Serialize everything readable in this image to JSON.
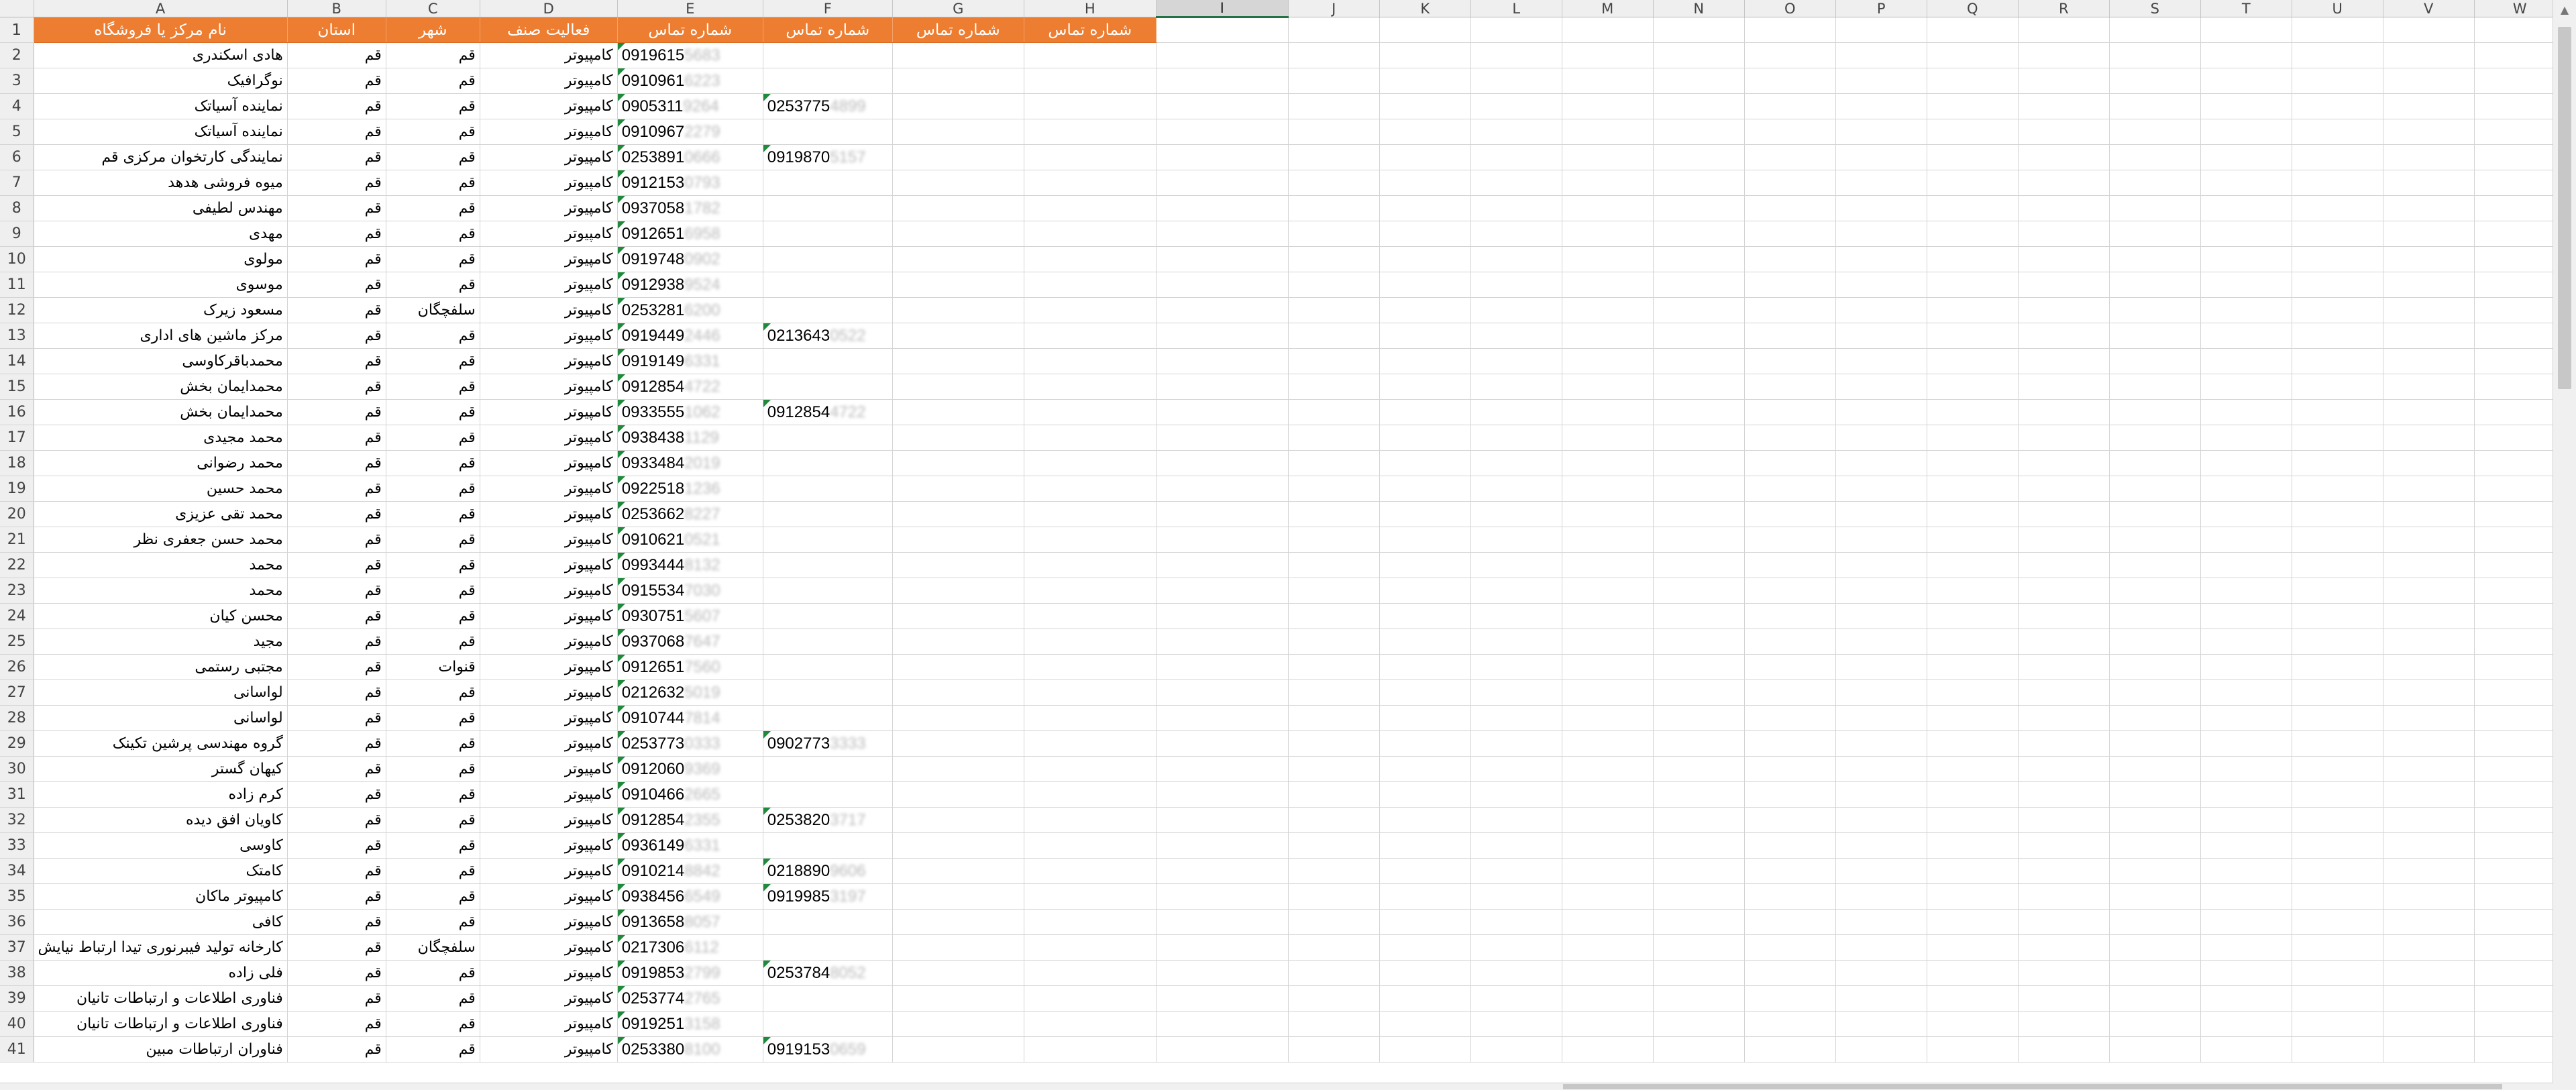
{
  "column_headers": [
    "A",
    "B",
    "C",
    "D",
    "E",
    "F",
    "G",
    "H",
    "I",
    "J",
    "K",
    "L",
    "M",
    "N",
    "O",
    "P",
    "Q",
    "R",
    "S",
    "T",
    "U",
    "V",
    "W"
  ],
  "selected_column": "I",
  "header_row": {
    "a": "نام مرکز یا فروشگاه",
    "b": "استان",
    "c": "شهر",
    "d": "فعالیت صنف",
    "e": "شماره تماس",
    "f": "شماره تماس",
    "g": "شماره تماس",
    "h": "شماره تماس"
  },
  "rows": [
    {
      "n": 2,
      "a": "هادی اسکندری",
      "b": "قم",
      "c": "قم",
      "d": "کامپیوتر",
      "e": "0919615",
      "e_h": "5683",
      "f": "",
      "f_h": ""
    },
    {
      "n": 3,
      "a": "نوگرافیک",
      "b": "قم",
      "c": "قم",
      "d": "کامپیوتر",
      "e": "0910961",
      "e_h": "6223",
      "f": "",
      "f_h": ""
    },
    {
      "n": 4,
      "a": "نماینده آسیاتک",
      "b": "قم",
      "c": "قم",
      "d": "کامپیوتر",
      "e": "0905311",
      "e_h": "9264",
      "f": "0253775",
      "f_h": "4899"
    },
    {
      "n": 5,
      "a": "نماینده آسیاتک",
      "b": "قم",
      "c": "قم",
      "d": "کامپیوتر",
      "e": "0910967",
      "e_h": "2279",
      "f": "",
      "f_h": ""
    },
    {
      "n": 6,
      "a": "نمایندگی کارتخوان مرکزی قم",
      "b": "قم",
      "c": "قم",
      "d": "کامپیوتر",
      "e": "0253891",
      "e_h": "0666",
      "f": "0919870",
      "f_h": "5157"
    },
    {
      "n": 7,
      "a": "میوه فروشی هدهد",
      "b": "قم",
      "c": "قم",
      "d": "کامپیوتر",
      "e": "0912153",
      "e_h": "0793",
      "f": "",
      "f_h": ""
    },
    {
      "n": 8,
      "a": "مهندس لطیفی",
      "b": "قم",
      "c": "قم",
      "d": "کامپیوتر",
      "e": "0937058",
      "e_h": "1782",
      "f": "",
      "f_h": ""
    },
    {
      "n": 9,
      "a": "مهدی",
      "b": "قم",
      "c": "قم",
      "d": "کامپیوتر",
      "e": "0912651",
      "e_h": "6958",
      "f": "",
      "f_h": ""
    },
    {
      "n": 10,
      "a": "مولوی",
      "b": "قم",
      "c": "قم",
      "d": "کامپیوتر",
      "e": "0919748",
      "e_h": "0902",
      "f": "",
      "f_h": ""
    },
    {
      "n": 11,
      "a": "موسوی",
      "b": "قم",
      "c": "قم",
      "d": "کامپیوتر",
      "e": "0912938",
      "e_h": "9524",
      "f": "",
      "f_h": ""
    },
    {
      "n": 12,
      "a": "مسعود زیرک",
      "b": "قم",
      "c": "سلفچگان",
      "d": "کامپیوتر",
      "e": "0253281",
      "e_h": "6200",
      "f": "",
      "f_h": ""
    },
    {
      "n": 13,
      "a": "مرکز ماشین های اداری",
      "b": "قم",
      "c": "قم",
      "d": "کامپیوتر",
      "e": "0919449",
      "e_h": "2446",
      "f": "0213643",
      "f_h": "0522"
    },
    {
      "n": 14,
      "a": "محمدباقرکاوسی",
      "b": "قم",
      "c": "قم",
      "d": "کامپیوتر",
      "e": "0919149",
      "e_h": "6331",
      "f": "",
      "f_h": ""
    },
    {
      "n": 15,
      "a": "محمدایمان بخش",
      "b": "قم",
      "c": "قم",
      "d": "کامپیوتر",
      "e": "0912854",
      "e_h": "4722",
      "f": "",
      "f_h": ""
    },
    {
      "n": 16,
      "a": "محمدایمان بخش",
      "b": "قم",
      "c": "قم",
      "d": "کامپیوتر",
      "e": "0933555",
      "e_h": "1062",
      "f": "0912854",
      "f_h": "4722"
    },
    {
      "n": 17,
      "a": "محمد مجیدی",
      "b": "قم",
      "c": "قم",
      "d": "کامپیوتر",
      "e": "0938438",
      "e_h": "1129",
      "f": "",
      "f_h": ""
    },
    {
      "n": 18,
      "a": "محمد رضوانی",
      "b": "قم",
      "c": "قم",
      "d": "کامپیوتر",
      "e": "0933484",
      "e_h": "2019",
      "f": "",
      "f_h": ""
    },
    {
      "n": 19,
      "a": "محمد حسین",
      "b": "قم",
      "c": "قم",
      "d": "کامپیوتر",
      "e": "0922518",
      "e_h": "1236",
      "f": "",
      "f_h": ""
    },
    {
      "n": 20,
      "a": "محمد تقی عزیزی",
      "b": "قم",
      "c": "قم",
      "d": "کامپیوتر",
      "e": "0253662",
      "e_h": "8227",
      "f": "",
      "f_h": ""
    },
    {
      "n": 21,
      "a": "محمد  حسن جعفری نظر",
      "b": "قم",
      "c": "قم",
      "d": "کامپیوتر",
      "e": "0910621",
      "e_h": "0521",
      "f": "",
      "f_h": ""
    },
    {
      "n": 22,
      "a": "محمد",
      "b": "قم",
      "c": "قم",
      "d": "کامپیوتر",
      "e": "0993444",
      "e_h": "8132",
      "f": "",
      "f_h": ""
    },
    {
      "n": 23,
      "a": "محمد",
      "b": "قم",
      "c": "قم",
      "d": "کامپیوتر",
      "e": "0915534",
      "e_h": "7030",
      "f": "",
      "f_h": ""
    },
    {
      "n": 24,
      "a": "محسن کیان",
      "b": "قم",
      "c": "قم",
      "d": "کامپیوتر",
      "e": "0930751",
      "e_h": "5607",
      "f": "",
      "f_h": ""
    },
    {
      "n": 25,
      "a": "مجید",
      "b": "قم",
      "c": "قم",
      "d": "کامپیوتر",
      "e": "0937068",
      "e_h": "7647",
      "f": "",
      "f_h": ""
    },
    {
      "n": 26,
      "a": "مجتبی رستمی",
      "b": "قم",
      "c": "قنوات",
      "d": "کامپیوتر",
      "e": "0912651",
      "e_h": "7560",
      "f": "",
      "f_h": ""
    },
    {
      "n": 27,
      "a": "لواسانی",
      "b": "قم",
      "c": "قم",
      "d": "کامپیوتر",
      "e": "0212632",
      "e_h": "5019",
      "f": "",
      "f_h": ""
    },
    {
      "n": 28,
      "a": "لواسانی",
      "b": "قم",
      "c": "قم",
      "d": "کامپیوتر",
      "e": "0910744",
      "e_h": "7814",
      "f": "",
      "f_h": ""
    },
    {
      "n": 29,
      "a": "گروه مهندسی پرشین تکینک",
      "b": "قم",
      "c": "قم",
      "d": "کامپیوتر",
      "e": "0253773",
      "e_h": "0333",
      "f": "0902773",
      "f_h": "3333"
    },
    {
      "n": 30,
      "a": "کیهان گستر",
      "b": "قم",
      "c": "قم",
      "d": "کامپیوتر",
      "e": "0912060",
      "e_h": "9369",
      "f": "",
      "f_h": ""
    },
    {
      "n": 31,
      "a": "کرم زاده",
      "b": "قم",
      "c": "قم",
      "d": "کامپیوتر",
      "e": "0910466",
      "e_h": "2665",
      "f": "",
      "f_h": ""
    },
    {
      "n": 32,
      "a": "کاویان افق دیده",
      "b": "قم",
      "c": "قم",
      "d": "کامپیوتر",
      "e": "0912854",
      "e_h": "2355",
      "f": "0253820",
      "f_h": "3717"
    },
    {
      "n": 33,
      "a": "کاوسی",
      "b": "قم",
      "c": "قم",
      "d": "کامپیوتر",
      "e": "0936149",
      "e_h": "6331",
      "f": "",
      "f_h": ""
    },
    {
      "n": 34,
      "a": "کامتک",
      "b": "قم",
      "c": "قم",
      "d": "کامپیوتر",
      "e": "0910214",
      "e_h": "8842",
      "f": "0218890",
      "f_h": "9606"
    },
    {
      "n": 35,
      "a": "کامپیوتر ماکان",
      "b": "قم",
      "c": "قم",
      "d": "کامپیوتر",
      "e": "0938456",
      "e_h": "6549",
      "f": "0919985",
      "f_h": "3197"
    },
    {
      "n": 36,
      "a": "کافی",
      "b": "قم",
      "c": "قم",
      "d": "کامپیوتر",
      "e": "0913658",
      "e_h": "8057",
      "f": "",
      "f_h": ""
    },
    {
      "n": 37,
      "a": "کارخانه تولید فیبرنوری تیدا ارتباط نیایش",
      "b": "قم",
      "c": "سلفچگان",
      "d": "کامپیوتر",
      "e": "0217306",
      "e_h": "6112",
      "f": "",
      "f_h": ""
    },
    {
      "n": 38,
      "a": "فلی زاده",
      "b": "قم",
      "c": "قم",
      "d": "کامپیوتر",
      "e": "0919853",
      "e_h": "2799",
      "f": "0253784",
      "f_h": "8052"
    },
    {
      "n": 39,
      "a": "فناوری اطلاعات و ارتباطات تانیان",
      "b": "قم",
      "c": "قم",
      "d": "کامپیوتر",
      "e": "0253774",
      "e_h": "2765",
      "f": "",
      "f_h": ""
    },
    {
      "n": 40,
      "a": "فناوری اطلاعات و ارتباطات تانیان",
      "b": "قم",
      "c": "قم",
      "d": "کامپیوتر",
      "e": "0919251",
      "e_h": "3158",
      "f": "",
      "f_h": ""
    },
    {
      "n": 41,
      "a": "فناوران ارتباطات مبین",
      "b": "قم",
      "c": "قم",
      "d": "کامپیوتر",
      "e": "0253380",
      "e_h": "8100",
      "f": "0919153",
      "f_h": "0659"
    }
  ]
}
